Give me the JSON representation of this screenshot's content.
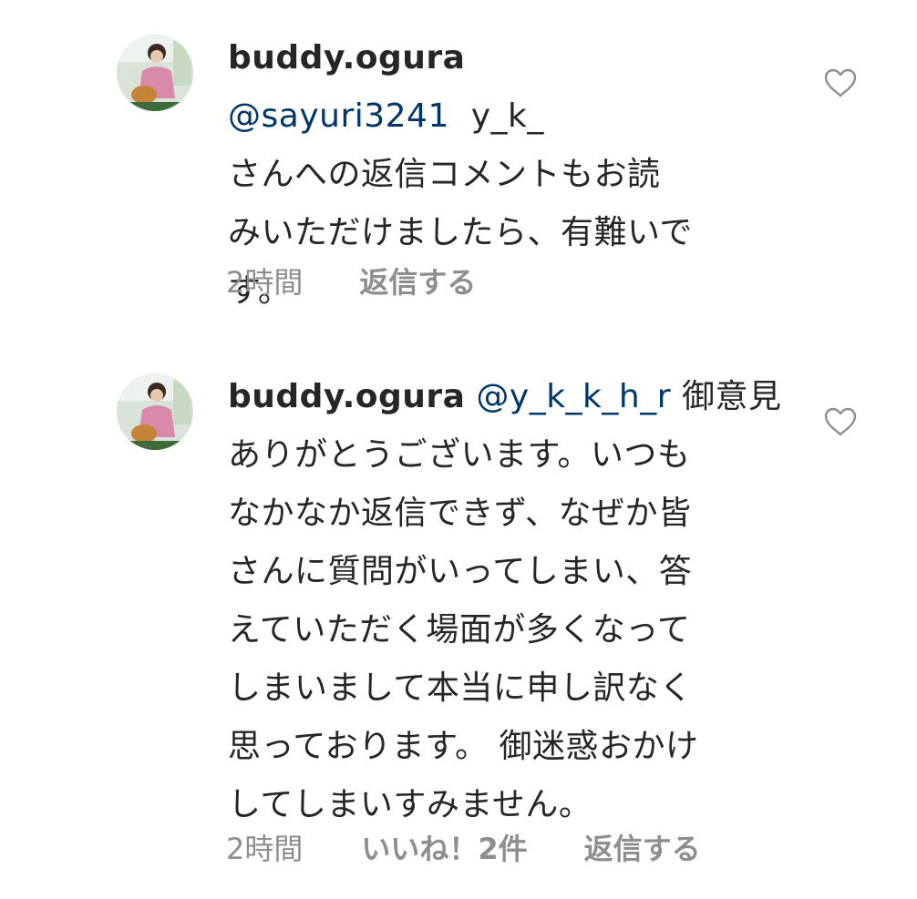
{
  "comments": [
    {
      "username": "buddy.ogura",
      "mention": "@sayuri3241",
      "text_lines": [
        "y_k_",
        "さんへの返信コメントもお読",
        "みいただけましたら、有難いで",
        "す。"
      ],
      "time": "2時間",
      "likes": "",
      "reply_label": "返信する"
    },
    {
      "username": "buddy.ogura",
      "mention": "@y_k_k_h_r",
      "text_lines": [
        "御意見",
        "ありがとうございます。いつも",
        "なかなか返信できず、なぜか皆",
        "さんに質問がいってしまい、答",
        "えていただく場面が多くなって",
        "しまいまして本当に申し訳なく",
        "思っております。 御迷惑おかけ",
        "してしまいすみません。"
      ],
      "time": "2時間",
      "likes": "いいね！2件",
      "reply_label": "返信する"
    }
  ],
  "icons": {
    "like": "heart-outline-icon",
    "avatar": "profile-photo"
  },
  "colors": {
    "text": "#262626",
    "mention": "#00376b",
    "meta": "#8e8e8e"
  }
}
